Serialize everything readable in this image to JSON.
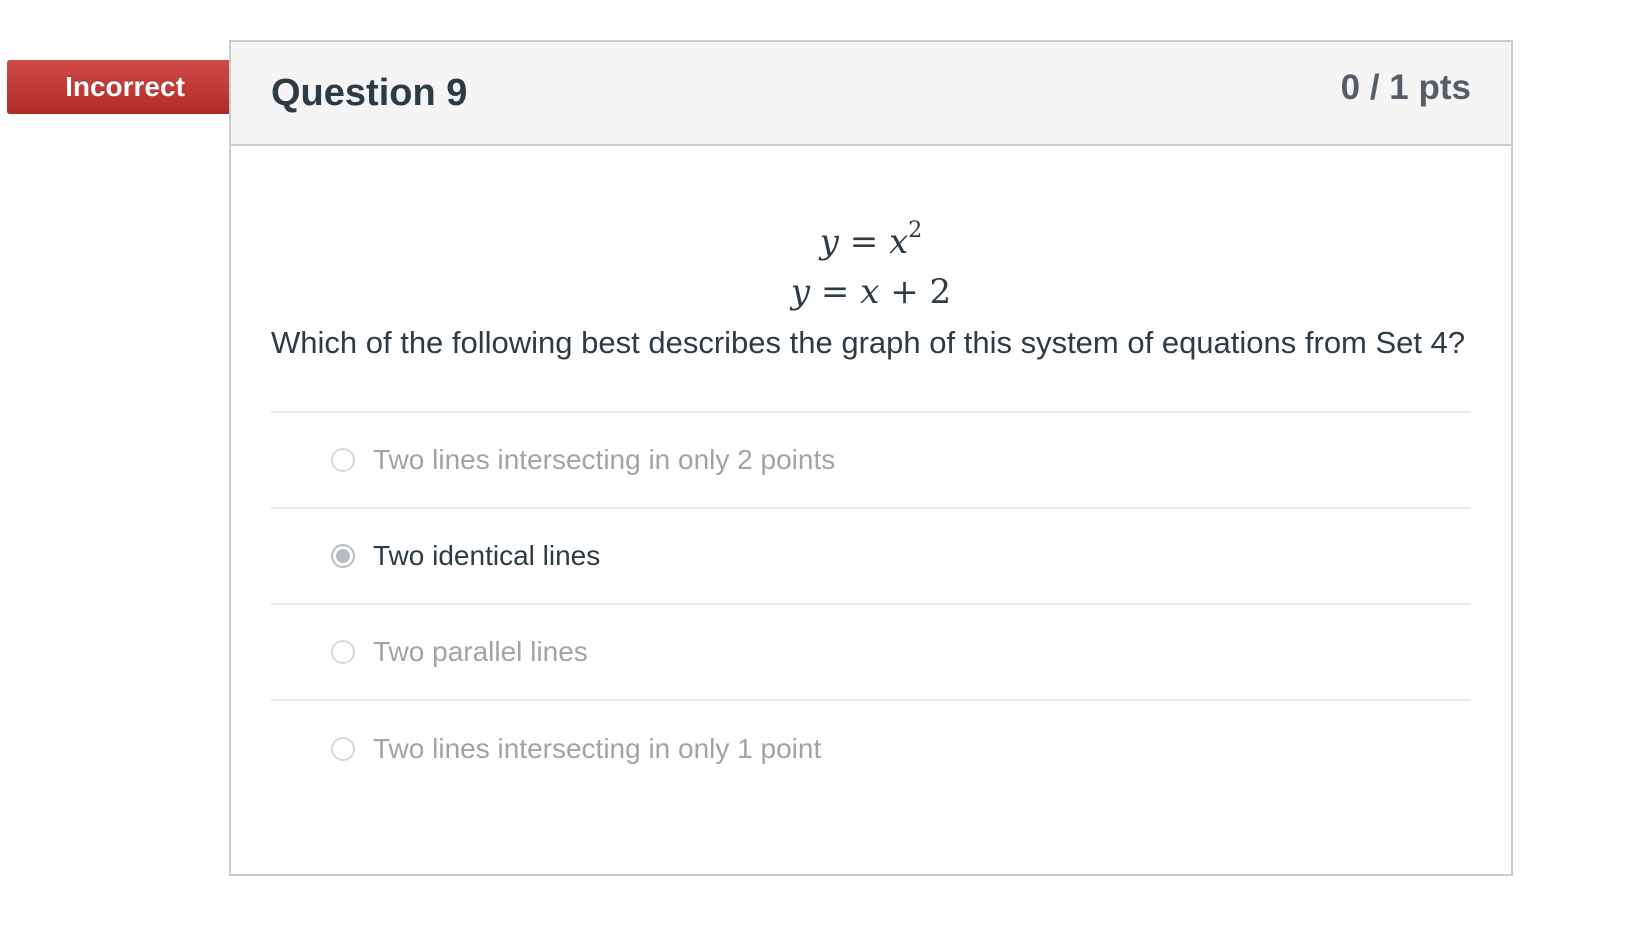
{
  "result": {
    "label": "Incorrect",
    "color": "#c0392b"
  },
  "question": {
    "title": "Question 9",
    "points": "0 / 1 pts",
    "equations": {
      "eq1": {
        "lhs": "y",
        "op": "=",
        "rhs_var": "x",
        "rhs_exp": "2"
      },
      "eq2": {
        "lhs": "y",
        "op": "=",
        "rhs_var": "x",
        "rhs_op": "+",
        "rhs_const": "2"
      }
    },
    "text": "Which of the following best describes the graph of this system of equations from Set 4?"
  },
  "answers": [
    {
      "label": "Two lines intersecting in only 2 points",
      "selected": false
    },
    {
      "label": "Two identical lines",
      "selected": true
    },
    {
      "label": "Two parallel lines",
      "selected": false
    },
    {
      "label": "Two lines intersecting in only 1 point",
      "selected": false
    }
  ]
}
